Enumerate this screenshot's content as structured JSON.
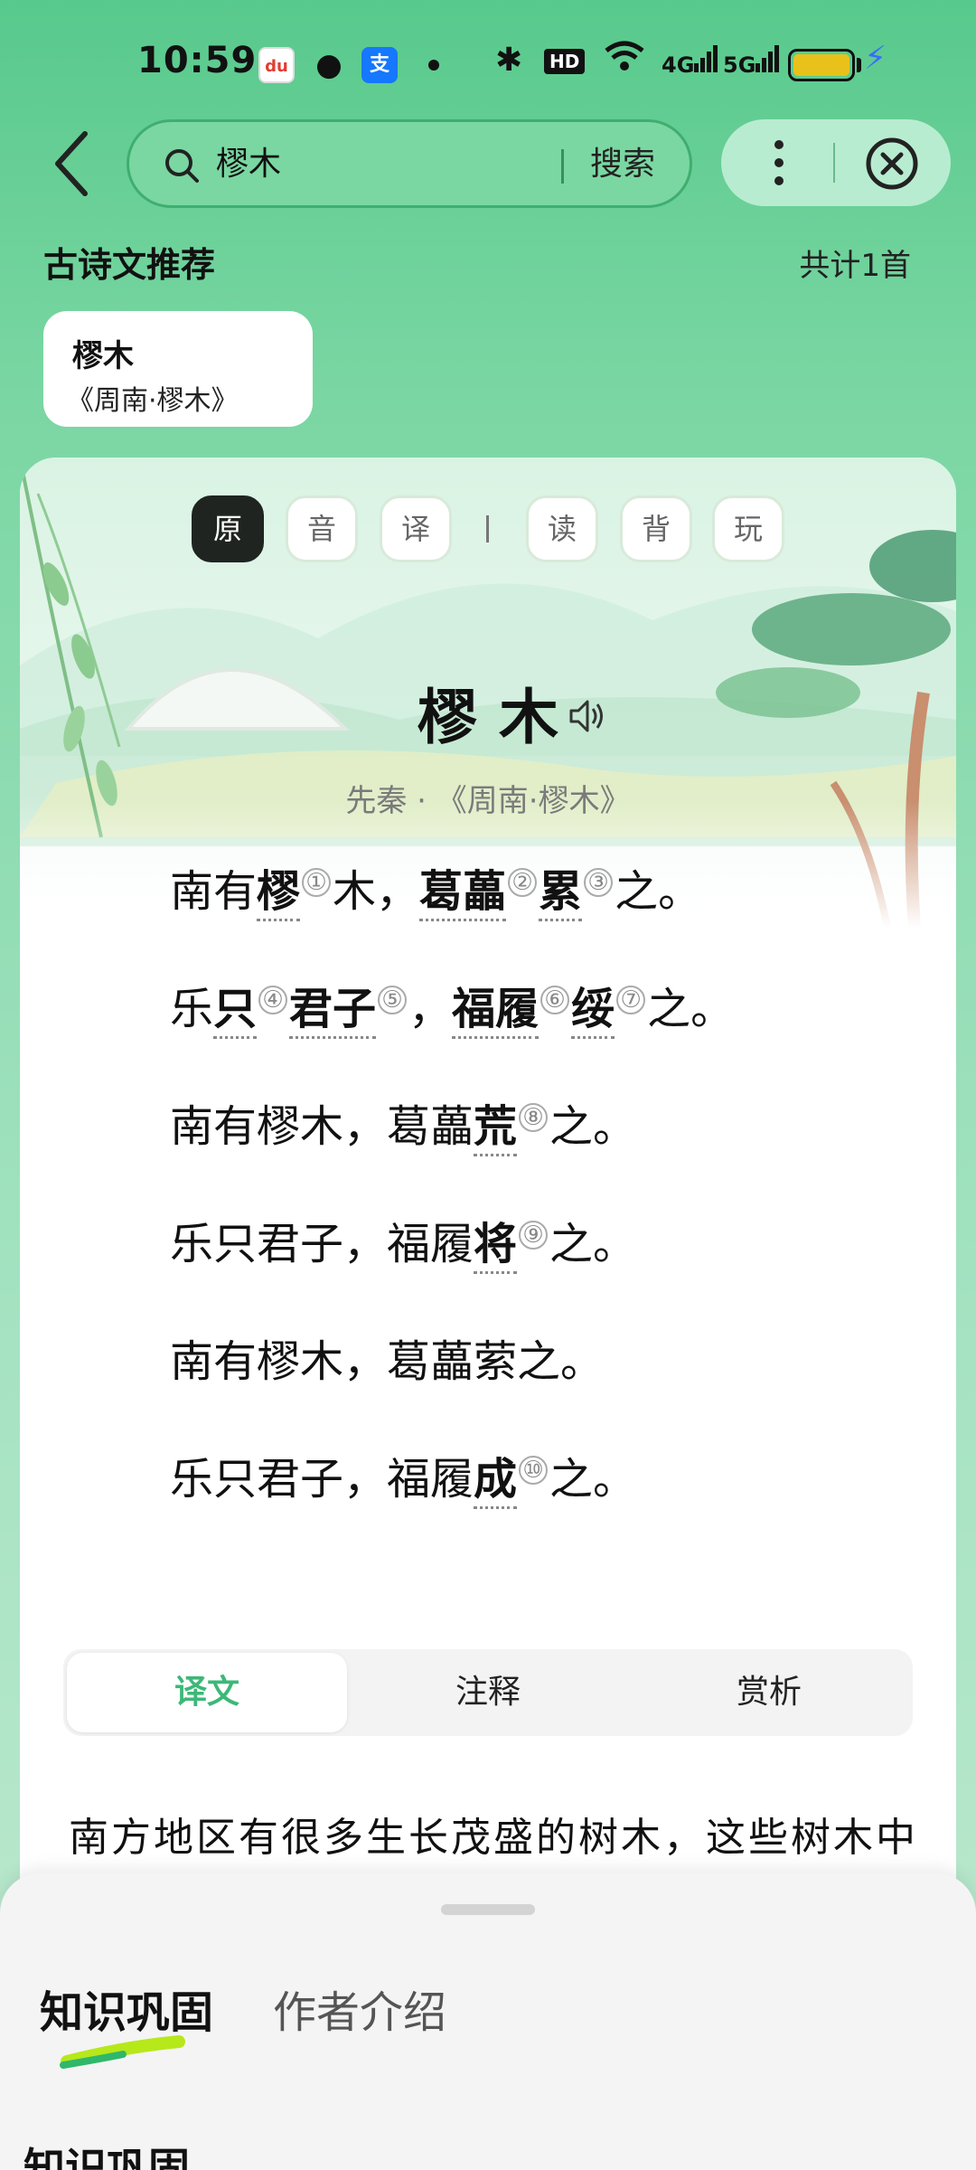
{
  "status_bar": {
    "time": "10:59",
    "apps": [
      "baidu-icon",
      "wechat-icon",
      "alipay-icon"
    ],
    "hd_label": "HD",
    "net1": "4G",
    "net2": "5G",
    "battery_color": "#e8c21a"
  },
  "search": {
    "query": "樛木",
    "button_label": "搜索"
  },
  "recommend": {
    "title": "古诗文推荐",
    "count": "共计1首",
    "card": {
      "title": "樛木",
      "subtitle": "《周南·樛木》"
    }
  },
  "mode_tabs": [
    "原",
    "音",
    "译",
    "读",
    "背",
    "玩"
  ],
  "poem": {
    "title": "樛木",
    "meta": "先秦 · 《周南·樛木》",
    "lines": [
      [
        {
          "t": "南有"
        },
        {
          "t": "樛",
          "kw": true
        },
        {
          "n": "①"
        },
        {
          "t": "木，"
        },
        {
          "t": "葛藟",
          "kw": true
        },
        {
          "n": "②"
        },
        {
          "t": "累",
          "kw": true
        },
        {
          "n": "③"
        },
        {
          "t": "之。"
        }
      ],
      [
        {
          "t": "乐"
        },
        {
          "t": "只",
          "kw": true
        },
        {
          "n": "④"
        },
        {
          "t": "君子",
          "kw": true
        },
        {
          "n": "⑤"
        },
        {
          "t": "，"
        },
        {
          "t": "福履",
          "kw": true
        },
        {
          "n": "⑥"
        },
        {
          "t": "绥",
          "kw": true
        },
        {
          "n": "⑦"
        },
        {
          "t": "之。"
        }
      ],
      [
        {
          "t": "南有樛木，葛藟"
        },
        {
          "t": "荒",
          "kw": true
        },
        {
          "n": "⑧"
        },
        {
          "t": "之。"
        }
      ],
      [
        {
          "t": "乐只君子，福履"
        },
        {
          "t": "将",
          "kw": true
        },
        {
          "n": "⑨"
        },
        {
          "t": "之。"
        }
      ],
      [
        {
          "t": "南有樛木，葛藟萦之。"
        }
      ],
      [
        {
          "t": "乐只君子，福履"
        },
        {
          "t": "成",
          "kw": true
        },
        {
          "n": "⑩"
        },
        {
          "t": "之。"
        }
      ]
    ]
  },
  "seg_tabs": [
    "译文",
    "注释",
    "赏析"
  ],
  "translation": "南方地区有很多生长茂盛的树木，这些树木中",
  "sheet": {
    "tabs": [
      "知识巩固",
      "作者介绍"
    ],
    "heading": "知识巩固"
  },
  "colors": {
    "accent": "#3cb878",
    "background_top": "#58c98c",
    "active_tab_bg": "#1f2421"
  }
}
